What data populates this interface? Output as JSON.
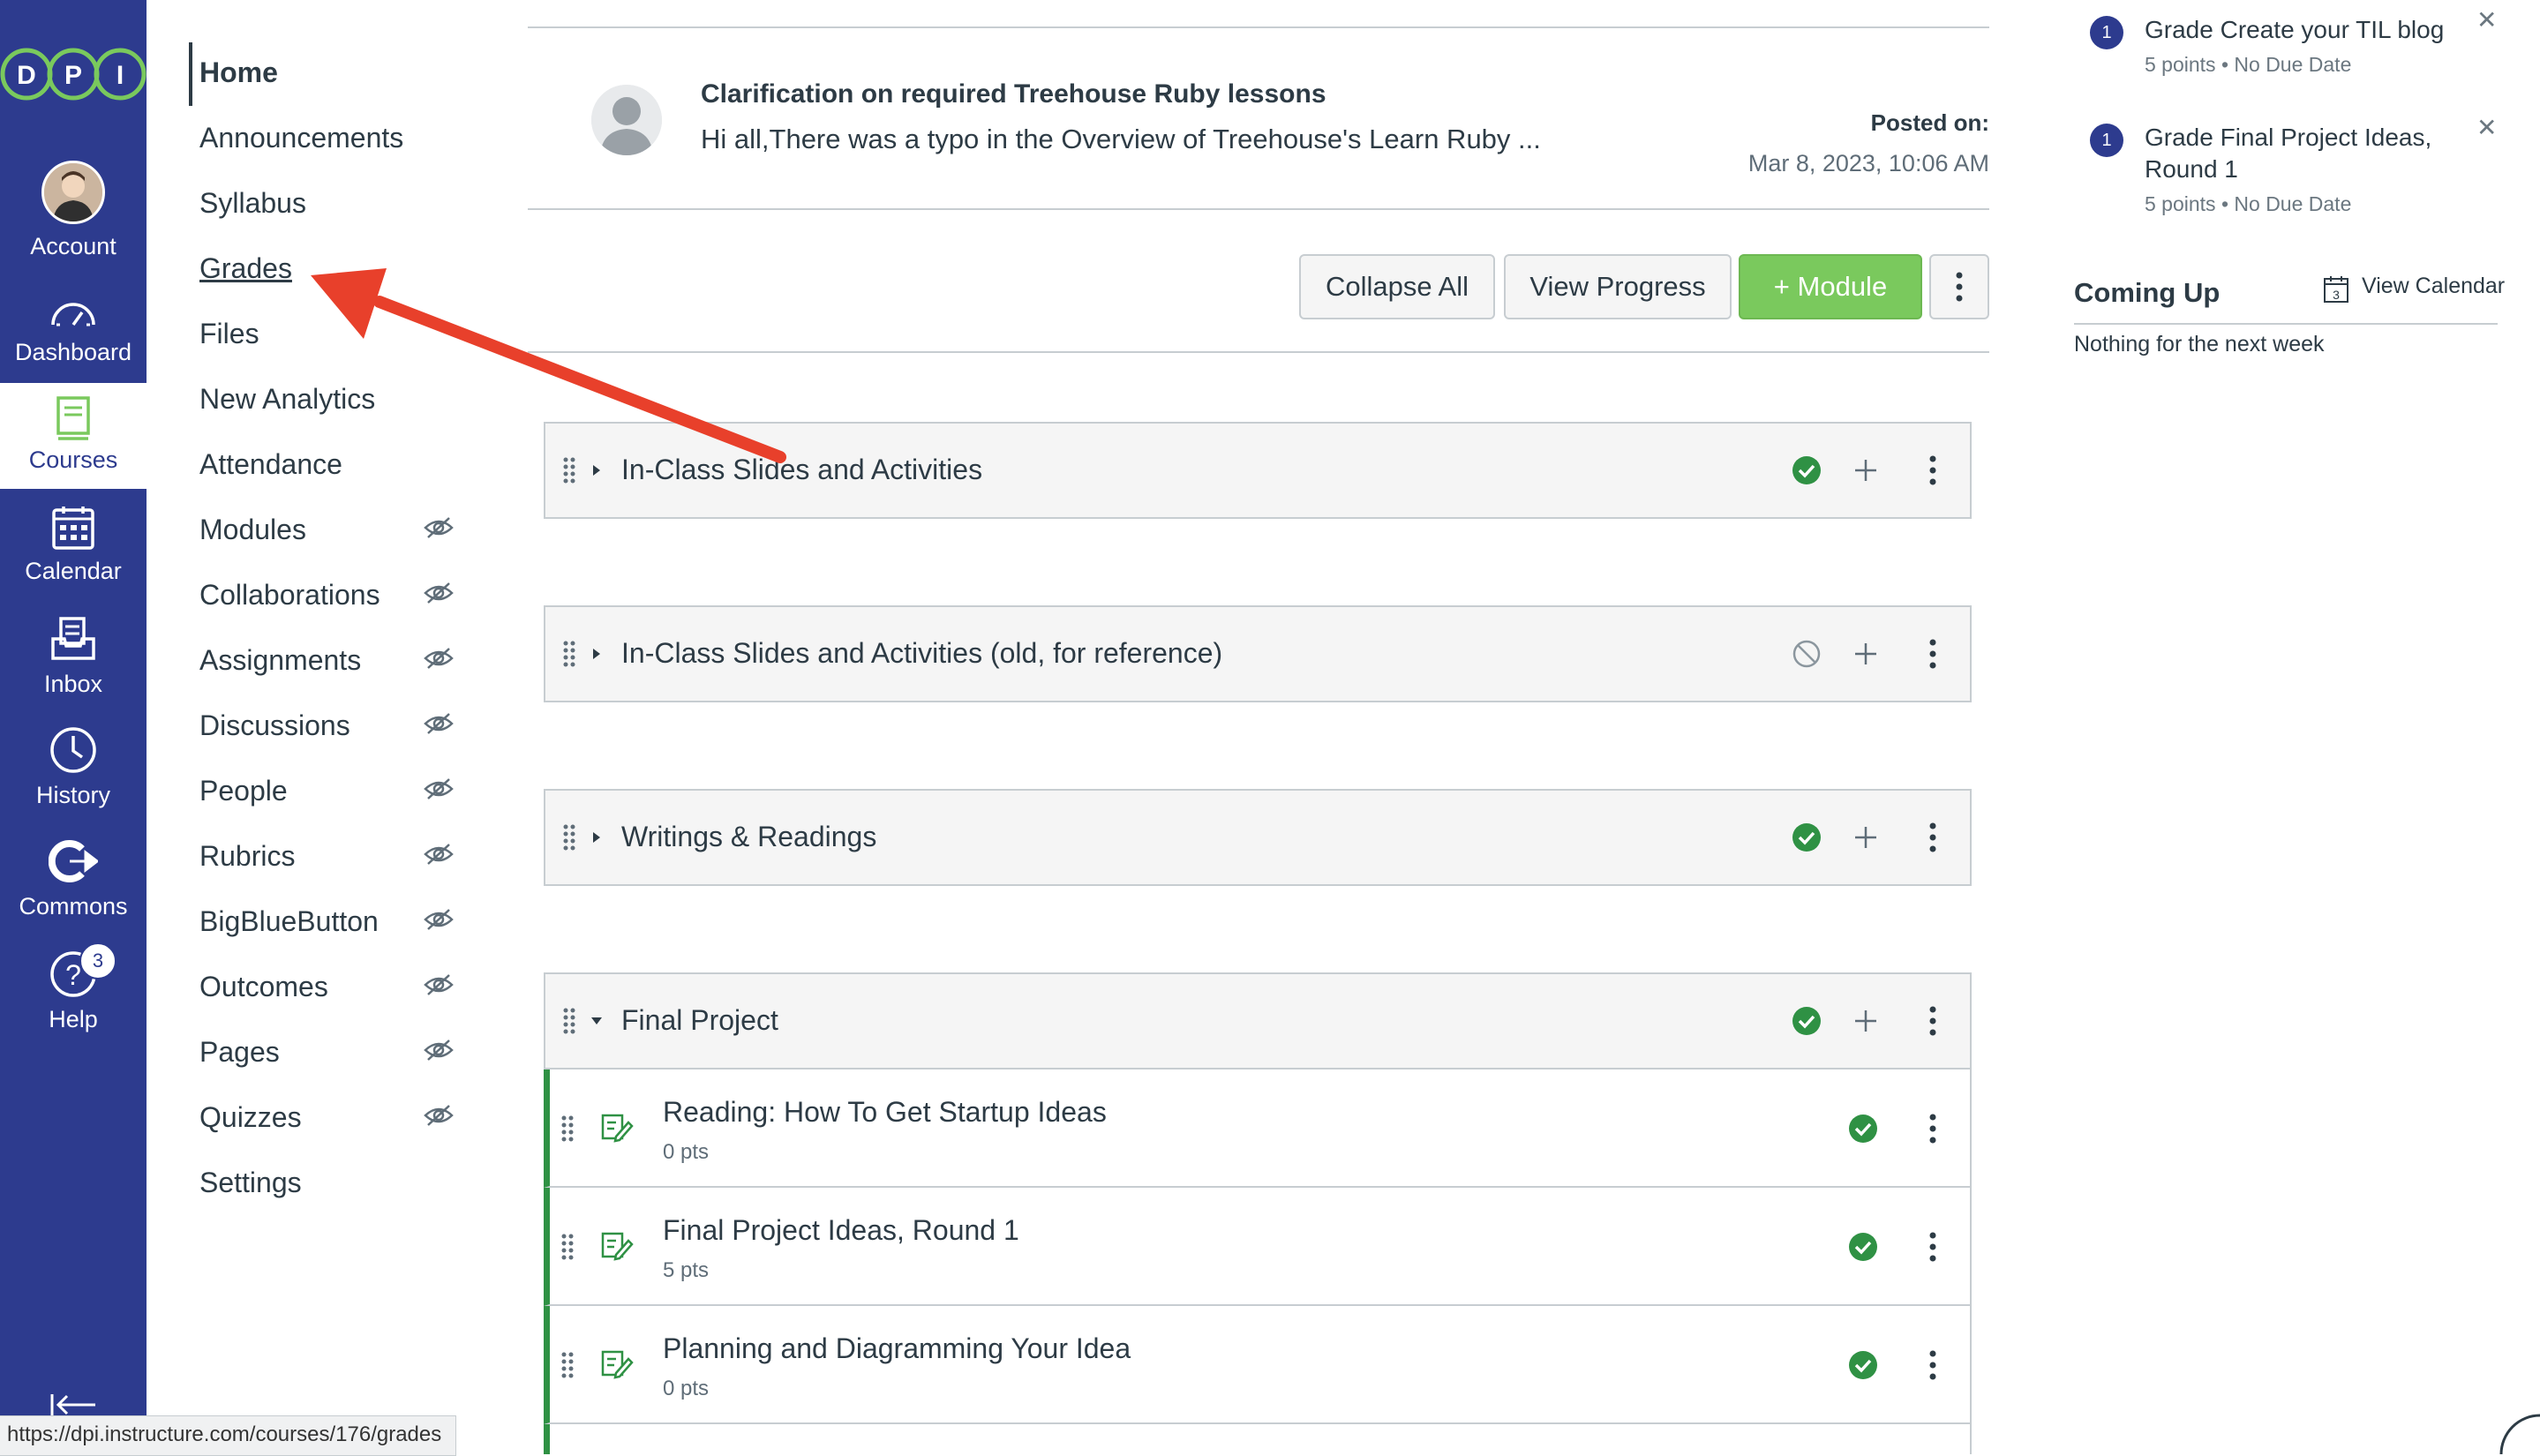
{
  "global_nav": {
    "logo_letters": [
      "D",
      "P",
      "I"
    ],
    "items": [
      {
        "label": "Account",
        "icon": "avatar"
      },
      {
        "label": "Dashboard",
        "icon": "dashboard-icon"
      },
      {
        "label": "Courses",
        "icon": "courses-icon",
        "active": true
      },
      {
        "label": "Calendar",
        "icon": "calendar-icon"
      },
      {
        "label": "Inbox",
        "icon": "inbox-icon"
      },
      {
        "label": "History",
        "icon": "history-icon"
      },
      {
        "label": "Commons",
        "icon": "commons-icon"
      },
      {
        "label": "Help",
        "icon": "help-icon",
        "badge": "3"
      }
    ],
    "colors": {
      "nav_bg": "#2d3b8e",
      "logo_green": "#7ac95d"
    }
  },
  "course_nav": {
    "items": [
      {
        "label": "Home",
        "hidden": false
      },
      {
        "label": "Announcements",
        "hidden": false
      },
      {
        "label": "Syllabus",
        "hidden": false
      },
      {
        "label": "Grades",
        "hidden": false
      },
      {
        "label": "Files",
        "hidden": false
      },
      {
        "label": "New Analytics",
        "hidden": false
      },
      {
        "label": "Attendance",
        "hidden": false
      },
      {
        "label": "Modules",
        "hidden": true
      },
      {
        "label": "Collaborations",
        "hidden": true
      },
      {
        "label": "Assignments",
        "hidden": true
      },
      {
        "label": "Discussions",
        "hidden": true
      },
      {
        "label": "People",
        "hidden": true
      },
      {
        "label": "Rubrics",
        "hidden": true
      },
      {
        "label": "BigBlueButton",
        "hidden": true
      },
      {
        "label": "Outcomes",
        "hidden": true
      },
      {
        "label": "Pages",
        "hidden": true
      },
      {
        "label": "Quizzes",
        "hidden": true
      },
      {
        "label": "Settings",
        "hidden": false
      }
    ]
  },
  "announcement": {
    "title": "Clarification on required Treehouse Ruby lessons",
    "excerpt": "Hi all,There was a typo in the Overview of Treehouse's Learn Ruby ...",
    "posted_label": "Posted on:",
    "posted_date": "Mar 8, 2023, 10:06 AM"
  },
  "toolbar": {
    "collapse_all": "Collapse All",
    "view_progress": "View Progress",
    "add_module": "+ Module"
  },
  "modules": [
    {
      "title": "In-Class Slides and Activities",
      "status": "published",
      "expanded": false
    },
    {
      "title": "In-Class Slides and Activities (old, for reference)",
      "status": "unpublished",
      "expanded": false
    },
    {
      "title": "Writings & Readings",
      "status": "published",
      "expanded": false
    },
    {
      "title": "Final Project",
      "status": "published",
      "expanded": true,
      "items": [
        {
          "title": "Reading: How To Get Startup Ideas",
          "points": "0 pts"
        },
        {
          "title": "Final Project Ideas, Round 1",
          "points": "5 pts"
        },
        {
          "title": "Planning and Diagramming Your Idea",
          "points": "0 pts"
        }
      ]
    }
  ],
  "todo": [
    {
      "badge": "1",
      "title_lines": [
        "Grade Create your TIL blog"
      ],
      "points": "5 points",
      "due": "No Due Date"
    },
    {
      "badge": "1",
      "title_lines": [
        "Grade Final Project Ideas,",
        "Round 1"
      ],
      "points": "5 points",
      "due": "No Due Date"
    }
  ],
  "coming_up": {
    "heading": "Coming Up",
    "view_calendar": "View Calendar",
    "empty_text": "Nothing for the next week",
    "calendar_day": "3"
  },
  "status_bar": {
    "url": "https://dpi.instructure.com/courses/176/grades"
  },
  "colors": {
    "published": "#2f9144",
    "accent_arrow": "#e8402b",
    "module_btn": "#7ac95d"
  }
}
